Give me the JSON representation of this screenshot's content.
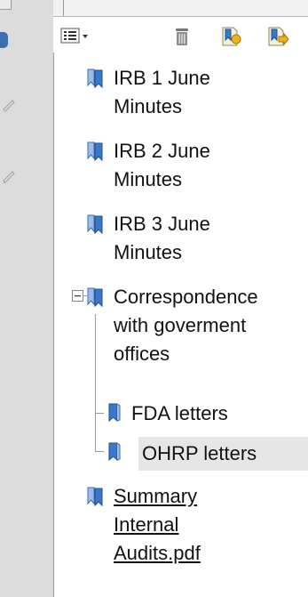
{
  "toolbar": {
    "options_icon": "options-menu-icon",
    "delete_icon": "trash-icon",
    "new_bookmark_icon": "new-bookmark-icon",
    "expand_bookmark_icon": "expand-bookmark-icon"
  },
  "bookmarks": [
    {
      "lines": [
        "IRB 1 June",
        "Minutes"
      ]
    },
    {
      "lines": [
        "IRB 2 June",
        "Minutes"
      ]
    },
    {
      "lines": [
        "IRB 3 June",
        "Minutes"
      ]
    },
    {
      "lines": [
        "Correspondence",
        "with goverment",
        "offices"
      ],
      "expanded": true,
      "children": [
        {
          "lines": [
            "FDA letters"
          ]
        },
        {
          "lines": [
            "OHRP letters"
          ],
          "selected": true
        }
      ]
    },
    {
      "lines": [
        "Summary",
        "Internal",
        "Audits.pdf"
      ],
      "link": true
    }
  ],
  "colors": {
    "bookmark_icon": "#3b78c9",
    "selection": "#e6e6e6",
    "panel_border": "#9a9a9a"
  }
}
